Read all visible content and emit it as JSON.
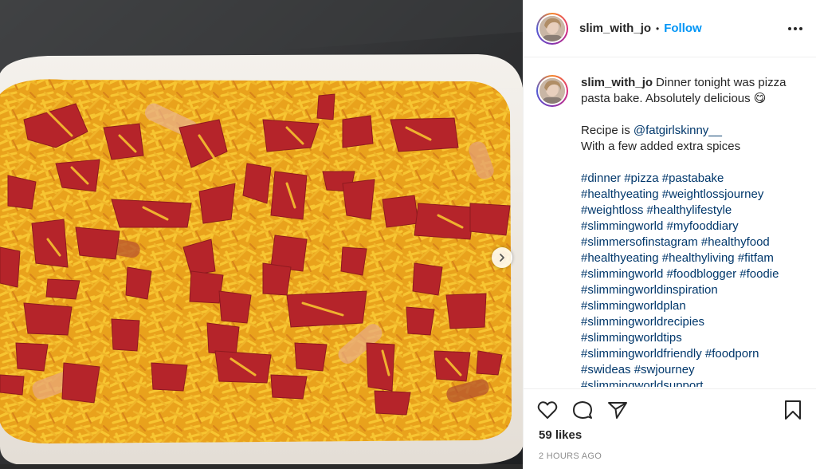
{
  "post": {
    "username": "slim_with_jo",
    "follow_label": "Follow",
    "separator": "•",
    "caption_text": "Dinner tonight was pizza pasta bake. Absolutely delicious 😋",
    "recipe_prefix": "Recipe is ",
    "recipe_mention": "@fatgirlskinny__",
    "recipe_suffix": "With a few added extra spices",
    "hashtag_lines": [
      "#dinner #pizza #pastabake",
      "#healthyeating #weightlossjourney",
      "#weightloss  #healthylifestyle",
      "#slimmingworld #myfooddiary",
      "#slimmersofinstagram  #healthyfood",
      "#healthyeating #healthyliving #fitfam",
      "#slimmingworld #foodblogger #foodie",
      "#slimmingworldinspiration",
      "#slimmingworldplan",
      "#slimmingworldrecipies",
      "#slimmingworldtips",
      "#slimmingworldfriendly #foodporn",
      "#swideas #swjourney",
      "#slimmingworldsupport"
    ],
    "likes": "59 likes",
    "timestamp": "2 HOURS AGO"
  },
  "icons": {
    "more": "more-options-icon",
    "like": "heart-icon",
    "comment": "comment-icon",
    "share": "share-icon",
    "save": "bookmark-icon",
    "next": "chevron-right-icon"
  },
  "colors": {
    "accent": "#0095f6",
    "hashtag": "#00376b",
    "text": "#262626",
    "muted": "#8e8e8e"
  }
}
